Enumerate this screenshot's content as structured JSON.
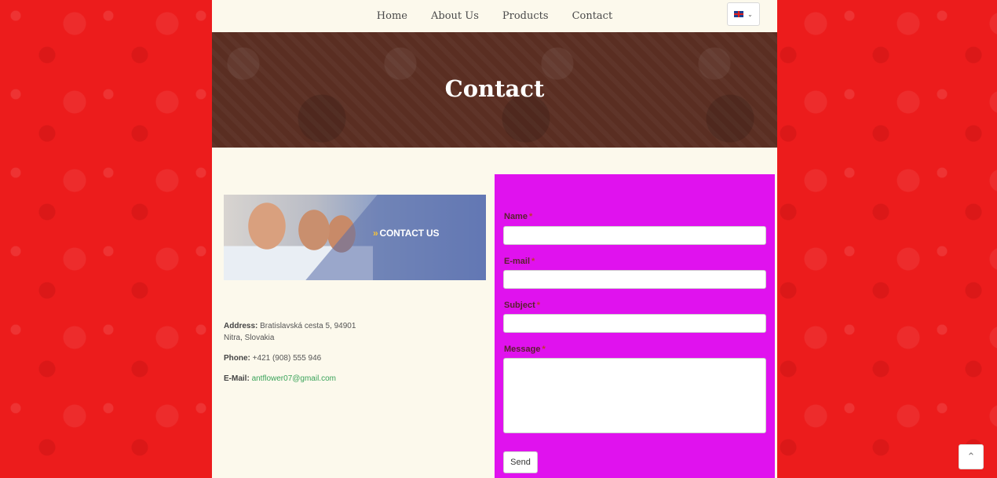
{
  "nav": {
    "links": [
      "Home",
      "About Us",
      "Products",
      "Contact"
    ],
    "language": {
      "icon": "uk-flag-icon",
      "chevron": "⌄"
    }
  },
  "hero": {
    "title": "Contact"
  },
  "banner": {
    "text": "CONTACT US",
    "accent_color": "#f5c23a"
  },
  "contact_info": {
    "address_label": "Address:",
    "address_line1": "Bratislavská cesta 5, 94901",
    "address_line2": "Nitra, Slovakia",
    "phone_label": "Phone:",
    "phone": "+421 (908) 555 946",
    "email_label": "E-Mail:",
    "email": "antflower07@gmail.com"
  },
  "form": {
    "name_label": "Name",
    "email_label": "E-mail",
    "subject_label": "Subject",
    "message_label": "Message",
    "required_mark": "*",
    "send_label": "Send",
    "panel_color": "#e012ee"
  },
  "scroll_top": {
    "icon": "chevron-up-icon",
    "glyph": "⌃"
  },
  "colors": {
    "background": "#ec1c1c",
    "page": "#fcf9ec",
    "hero": "#5a2e22",
    "link": "#3aa35a"
  }
}
